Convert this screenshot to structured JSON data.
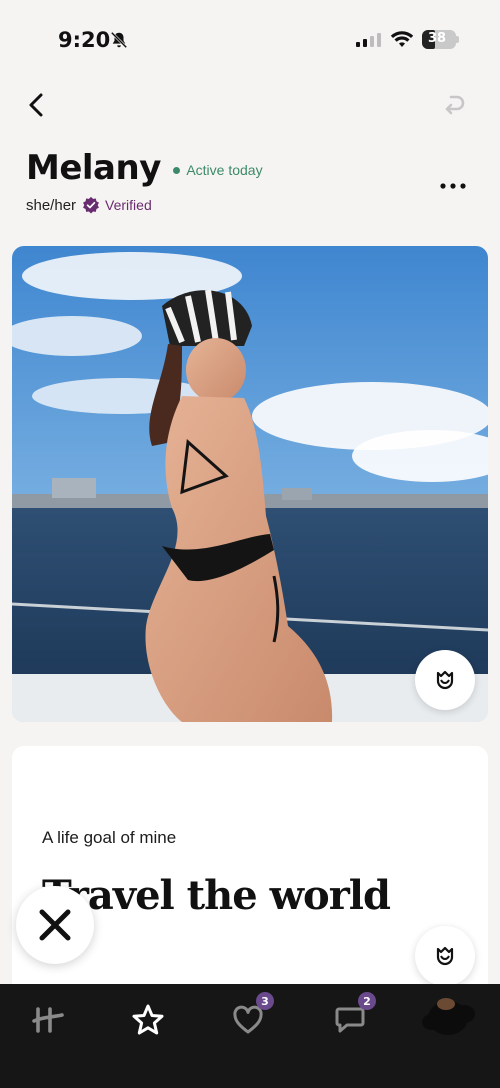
{
  "status_bar": {
    "time": "9:20",
    "battery_level": "38",
    "battery_fraction": 0.38
  },
  "header": {
    "back_icon": "chevron-left-icon",
    "undo_icon": "undo-arrow-icon"
  },
  "profile": {
    "name": "Melany",
    "activity": "Active today",
    "pronouns": "she/her",
    "verified_label": "Verified",
    "more_icon": "more-dots-icon"
  },
  "photo": {
    "like_icon": "rose-icon"
  },
  "prompt": {
    "question": "A life goal of mine",
    "answer": "Travel the world",
    "like_icon": "rose-icon"
  },
  "actions": {
    "skip_icon": "close-x-icon"
  },
  "tab_bar": {
    "tabs": [
      {
        "name": "home",
        "icon": "hinge-logo-icon"
      },
      {
        "name": "standouts",
        "icon": "star-icon"
      },
      {
        "name": "likes-you",
        "icon": "heart-icon",
        "badge": "3"
      },
      {
        "name": "matches",
        "icon": "chat-bubble-icon",
        "badge": "2"
      },
      {
        "name": "profile",
        "icon": "avatar-icon"
      }
    ]
  },
  "colors": {
    "background": "#f6f4f2",
    "active_green": "#3d8a6a",
    "verified_purple": "#6a2c70",
    "tab_bar": "#161616",
    "badge": "#6a4a8c"
  }
}
